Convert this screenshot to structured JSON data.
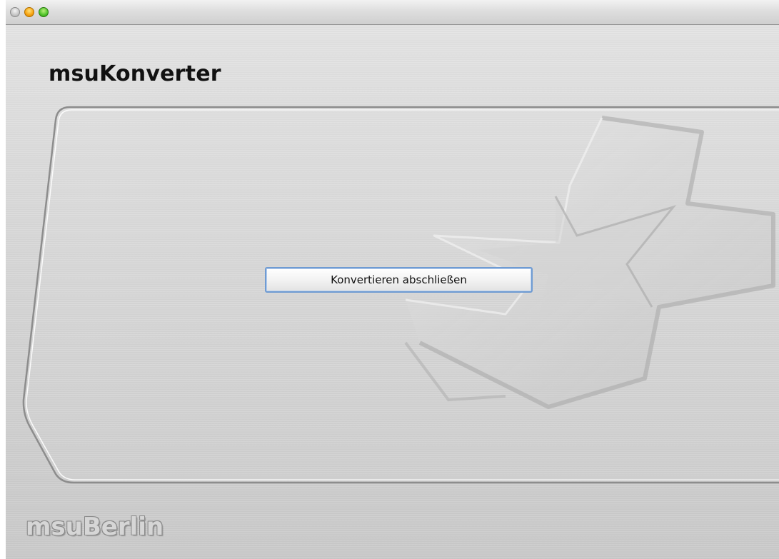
{
  "window": {
    "controls": [
      "close",
      "minimize",
      "maximize"
    ]
  },
  "app": {
    "title": "msuKonverter",
    "brand": "msuBerlin"
  },
  "main": {
    "action_button_label": "Konvertieren abschließen"
  },
  "icons": {
    "background_logo": "cross-star-logo-icon"
  },
  "colors": {
    "button_focus_ring": "#6f9bd2",
    "traffic_close": "#bdbdbd",
    "traffic_minimize": "#f6a10f",
    "traffic_maximize": "#4ec22a"
  }
}
